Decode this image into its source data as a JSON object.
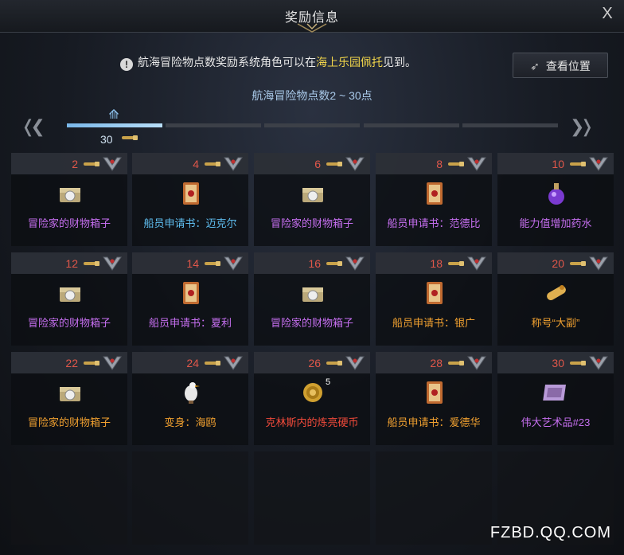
{
  "dialog": {
    "title": "奖励信息",
    "close_label": "X"
  },
  "info": {
    "prefix": "航海冒险物点数奖励系统角色可以在",
    "highlight": "海上乐园佩托",
    "suffix": "见到。"
  },
  "view_button": {
    "label": "查看位置"
  },
  "range_text": "航海冒险物点数2 ~ 30点",
  "progress": {
    "current": "30",
    "active_segment": 1,
    "total_segments": 5
  },
  "rewards": [
    {
      "points": "2",
      "name": "冒险家的财物箱子",
      "color": "purple",
      "icon": "treasure-chest-icon"
    },
    {
      "points": "4",
      "name": "船员申请书：迈克尔",
      "color": "blue",
      "icon": "scroll-icon"
    },
    {
      "points": "6",
      "name": "冒险家的财物箱子",
      "color": "purple",
      "icon": "treasure-chest-icon"
    },
    {
      "points": "8",
      "name": "船员申请书：范德比",
      "color": "purple",
      "icon": "scroll-icon"
    },
    {
      "points": "10",
      "name": "能力值增加药水",
      "color": "purple",
      "icon": "potion-icon"
    },
    {
      "points": "12",
      "name": "冒险家的财物箱子",
      "color": "purple",
      "icon": "treasure-chest-icon"
    },
    {
      "points": "14",
      "name": "船员申请书：夏利",
      "color": "purple",
      "icon": "scroll-icon"
    },
    {
      "points": "16",
      "name": "冒险家的财物箱子",
      "color": "purple",
      "icon": "treasure-chest-icon"
    },
    {
      "points": "18",
      "name": "船员申请书：银广",
      "color": "orange",
      "icon": "scroll-icon"
    },
    {
      "points": "20",
      "name": "称号“大副”",
      "color": "orange",
      "icon": "title-scroll-icon"
    },
    {
      "points": "22",
      "name": "冒险家的财物箱子",
      "color": "orange",
      "icon": "treasure-chest-icon"
    },
    {
      "points": "24",
      "name": "变身：海鸥",
      "color": "orange",
      "icon": "seagull-icon"
    },
    {
      "points": "26",
      "name": "克林斯内的炼亮硬币",
      "color": "red",
      "icon": "coin-icon",
      "qty": "5"
    },
    {
      "points": "28",
      "name": "船员申请书：爱德华",
      "color": "orange",
      "icon": "scroll-icon"
    },
    {
      "points": "30",
      "name": "伟大艺术品#23",
      "color": "purple",
      "icon": "painting-icon"
    }
  ],
  "watermark": "FZBD.QQ.COM"
}
